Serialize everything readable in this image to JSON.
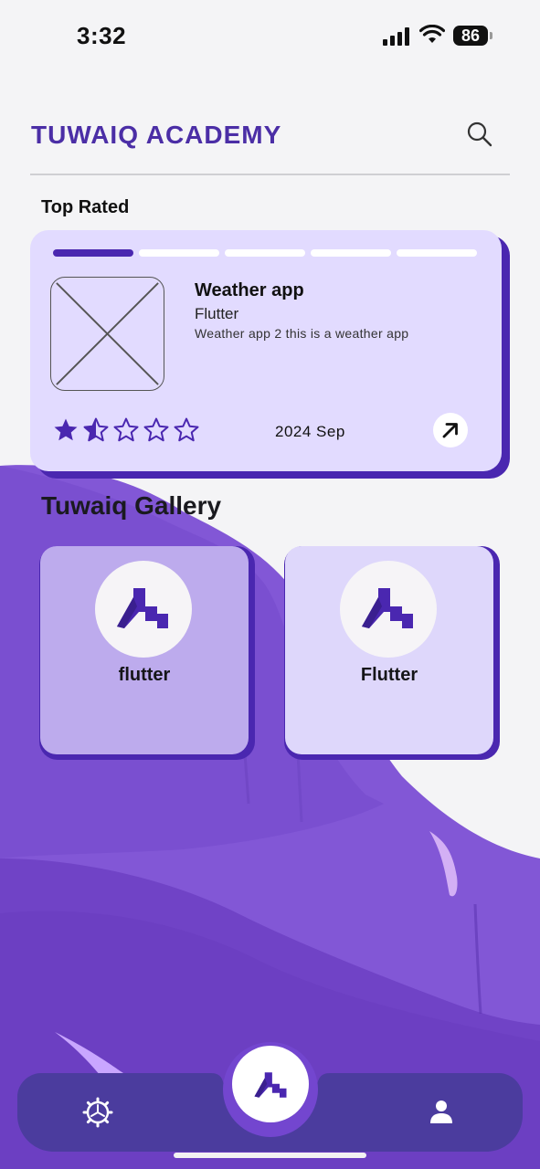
{
  "status_bar": {
    "time": "3:32",
    "battery": "86"
  },
  "header": {
    "title": "TUWAIQ ACADEMY",
    "search_icon": "search-icon"
  },
  "top_rated": {
    "label": "Top Rated",
    "carousel": {
      "pages": 5,
      "active_page": 1
    },
    "card": {
      "title": "Weather app",
      "subtitle": "Flutter",
      "description": "Weather app 2 this is a weather app",
      "rating": 1.5,
      "rating_max": 5,
      "date": "2024 Sep",
      "open_icon": "arrow-up-right-icon"
    }
  },
  "gallery": {
    "title": "Tuwaiq Gallery",
    "items": [
      {
        "label": "flutter",
        "icon": "tuwaiq-logo-icon"
      },
      {
        "label": "Flutter",
        "icon": "tuwaiq-logo-icon"
      }
    ]
  },
  "bottom_nav": {
    "items": [
      {
        "icon": "settings-icon"
      },
      {
        "icon": "tuwaiq-logo-icon"
      },
      {
        "icon": "profile-icon"
      }
    ]
  },
  "colors": {
    "accent": "#4b2ea6",
    "card_bg": "#e2dbff",
    "shadow": "#4a27b0",
    "nav_bg": "#4b3c9e"
  }
}
